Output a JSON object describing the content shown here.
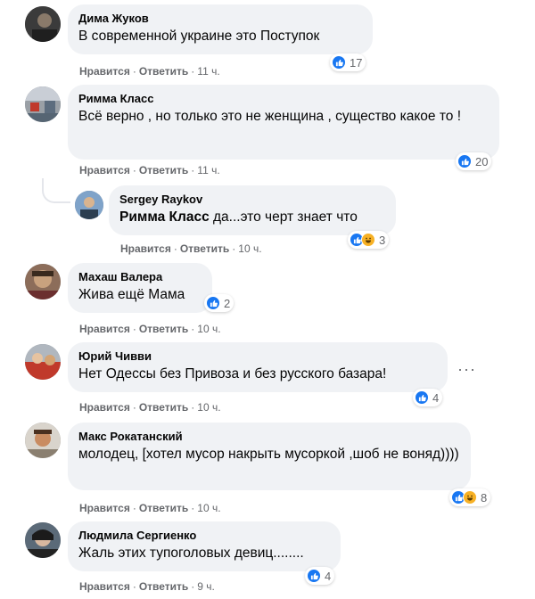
{
  "actions": {
    "like": "Нравится",
    "reply": "Ответить",
    "separator": "·"
  },
  "comments": [
    {
      "author": "Дима Жуков",
      "text": "В современной украине это Поступок",
      "time": "11 ч.",
      "reactions": "17"
    },
    {
      "author": "Римма Класс",
      "text": "Всё верно , но только это не женщина , существо какое то !",
      "time": "11 ч.",
      "reactions": "20"
    },
    {
      "author": "Sergey Raykov",
      "mention": "Римма Класс",
      "text": " да...это черт знает что",
      "time": "10 ч.",
      "reactions": "3"
    },
    {
      "author": "Махаш Валера",
      "text": "Жива ещё Мама",
      "time": "10 ч.",
      "reactions": "2"
    },
    {
      "author": "Юрий Чивви",
      "text": "Нет Одессы без Привоза и без русского базара!",
      "time": "10 ч.",
      "reactions": "4"
    },
    {
      "author": "Макс Рокатанский",
      "text": "молодец, [хотел мусор накрыть мусоркой ,шоб не воняд))))",
      "time": "10 ч.",
      "reactions": "8"
    },
    {
      "author": "Людмила Сергиенко",
      "text": "Жаль этих тупоголовых девиц........",
      "time": "9 ч.",
      "reactions": "4"
    }
  ],
  "colors": {
    "like": "#1877f2",
    "haha": "#f7b125",
    "bubble": "#f0f2f5",
    "meta": "#65676b"
  }
}
